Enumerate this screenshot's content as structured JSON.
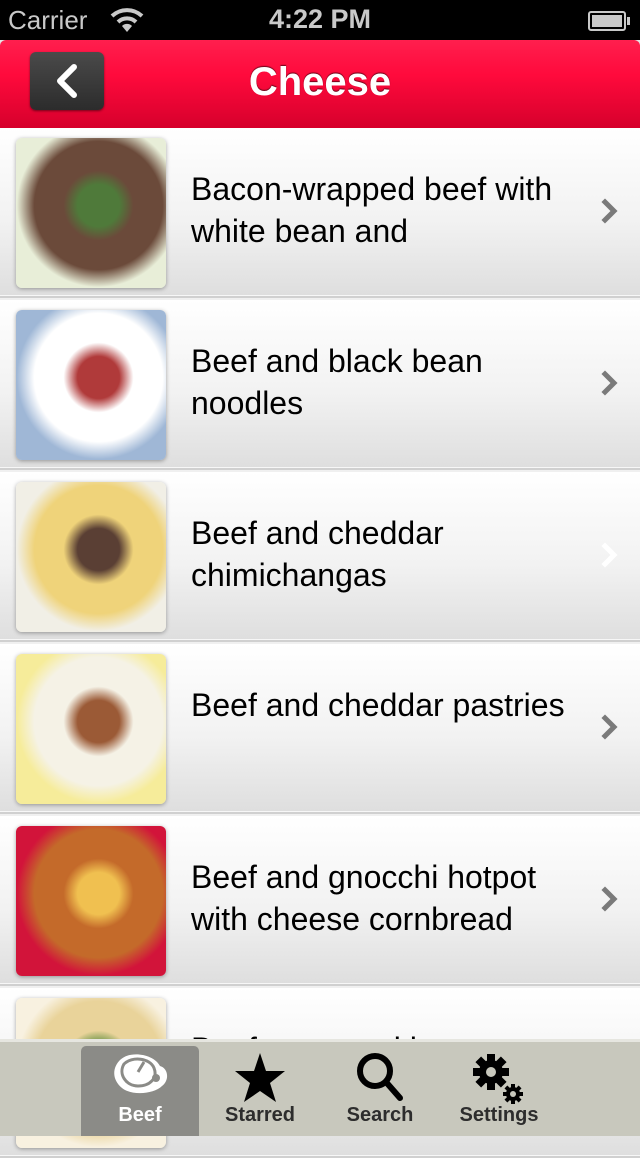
{
  "status_bar": {
    "carrier": "Carrier",
    "time": "4:22 PM"
  },
  "nav": {
    "title": "Cheese",
    "back_icon": "chevron-left-icon"
  },
  "colors": {
    "nav_red": "#ff0a3c",
    "tab_bar": "#c8c8bd",
    "tab_active": "#8b8b87"
  },
  "recipes": [
    {
      "title": "Bacon-wrapped beef with white bean and",
      "thumb_colors": [
        "#e8eed8",
        "#6b4a3a",
        "#4f7a3a"
      ],
      "chevron": "chevron-right-icon"
    },
    {
      "title": "Beef and black bean noodles",
      "thumb_colors": [
        "#9fb7d6",
        "#ffffff",
        "#b03a3a"
      ],
      "chevron": "chevron-right-icon"
    },
    {
      "title": "Beef and cheddar chimichangas",
      "thumb_colors": [
        "#f1efe6",
        "#efd37a",
        "#5a3f34"
      ],
      "chevron": "chevron-right-icon",
      "highlighted_chevron": true
    },
    {
      "title": "Beef and cheddar pastries",
      "thumb_colors": [
        "#f6ec9a",
        "#f5f2e6",
        "#9b5a36"
      ],
      "chevron": "chevron-right-icon"
    },
    {
      "title": "Beef and gnocchi hotpot with cheese cornbread",
      "thumb_colors": [
        "#d2143a",
        "#c46a2a",
        "#f0c050"
      ],
      "chevron": "chevron-right-icon"
    },
    {
      "title": "Beef crepes with gruyere",
      "thumb_colors": [
        "#f8f1e0",
        "#e9d39a",
        "#5a8a3a"
      ],
      "chevron": "chevron-right-icon"
    }
  ],
  "tabs": [
    {
      "label": "Beef",
      "icon": "steak-icon",
      "active": true
    },
    {
      "label": "Starred",
      "icon": "star-icon",
      "active": false
    },
    {
      "label": "Search",
      "icon": "search-icon",
      "active": false
    },
    {
      "label": "Settings",
      "icon": "gears-icon",
      "active": false
    }
  ]
}
